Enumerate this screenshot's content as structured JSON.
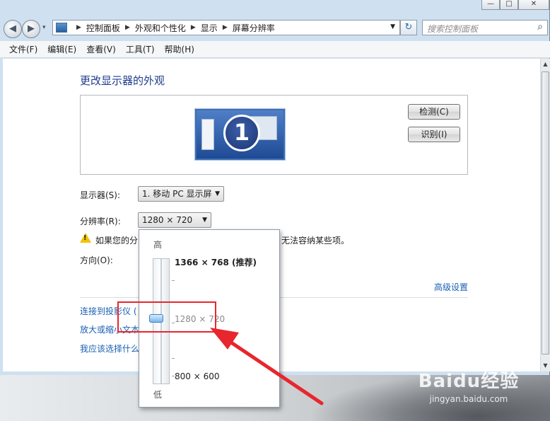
{
  "window": {
    "caption": {
      "minimize": "—",
      "maximize": "□",
      "close": "✕"
    }
  },
  "nav": {
    "back_icon": "◀",
    "forward_icon": "▶",
    "recent_icon": "▾",
    "breadcrumbs": [
      "控制面板",
      "外观和个性化",
      "显示",
      "屏幕分辨率"
    ],
    "search_placeholder": "搜索控制面板",
    "refresh_icon": "↻",
    "search_icon": "⌕"
  },
  "menu": {
    "items": [
      "文件(F)",
      "编辑(E)",
      "查看(V)",
      "工具(T)",
      "帮助(H)"
    ]
  },
  "content": {
    "title": "更改显示器的外观",
    "monitor_number": "1",
    "detect_label": "检测(C)",
    "identify_label": "识别(I)",
    "display_label": "显示器(S):",
    "display_value": "1. 移动 PC 显示屏",
    "resolution_label": "分辨率(R):",
    "resolution_value": "1280 × 720",
    "warning_text": "如果您的分",
    "warning_text_tail": "无法容纳某些项。",
    "orientation_label": "方向(O):",
    "advanced_link": "高级设置",
    "links": [
      "连接到投影仪 (",
      "放大或缩小文本",
      "我应该选择什么"
    ]
  },
  "resolution_popup": {
    "high_label": "高",
    "low_label": "低",
    "max_option": "1366 × 768 (推荐)",
    "current_option": "1280 × 720",
    "min_option": "800 × 600",
    "slider_level": 0.5
  },
  "watermark": {
    "logo": "Baidu经验",
    "url": "jingyan.baidu.com"
  },
  "colors": {
    "accent_link": "#1a5fb4",
    "title": "#1e3c8c",
    "highlight": "#e8262d"
  }
}
